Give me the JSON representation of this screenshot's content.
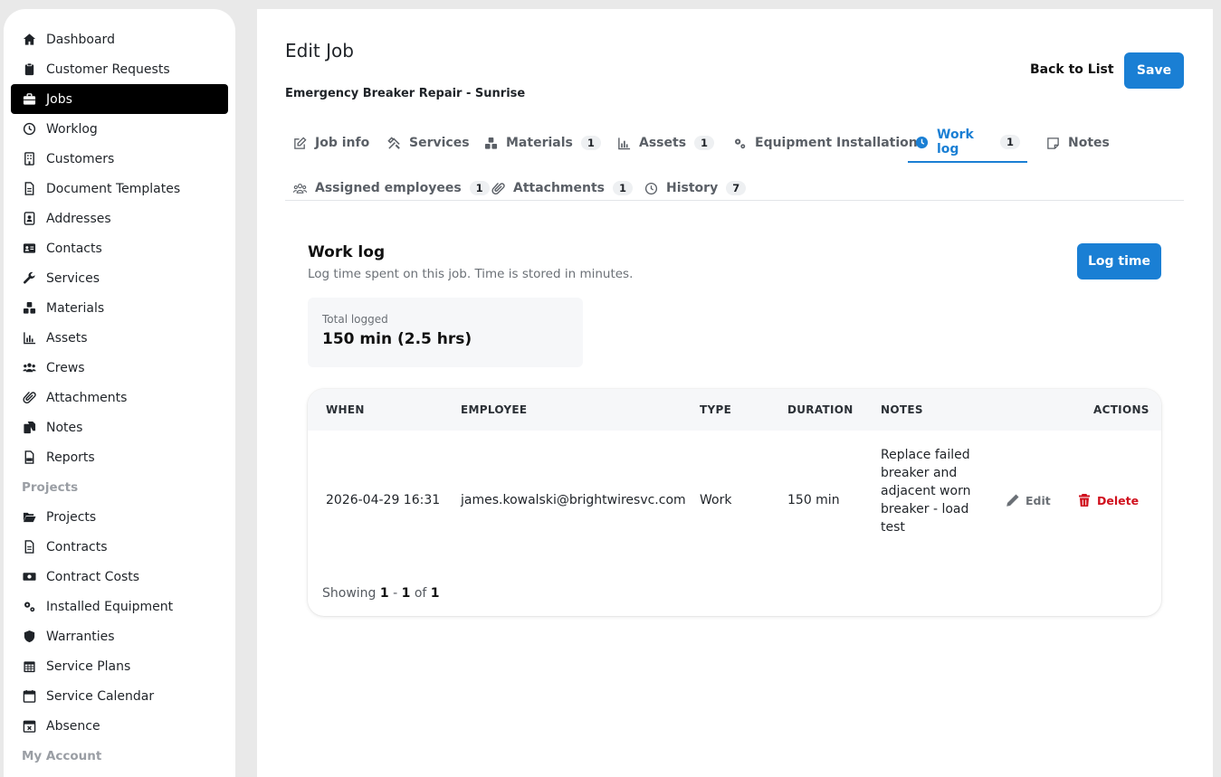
{
  "sidebar": {
    "items": [
      {
        "label": "Dashboard",
        "icon": "home-icon"
      },
      {
        "label": "Customer Requests",
        "icon": "clipboard-icon"
      },
      {
        "label": "Jobs",
        "icon": "briefcase-icon",
        "active": true
      },
      {
        "label": "Worklog",
        "icon": "clock-icon"
      },
      {
        "label": "Customers",
        "icon": "building-icon"
      },
      {
        "label": "Document Templates",
        "icon": "document-icon"
      },
      {
        "label": "Addresses",
        "icon": "address-book-icon"
      },
      {
        "label": "Contacts",
        "icon": "id-card-icon"
      },
      {
        "label": "Services",
        "icon": "wrench-icon"
      },
      {
        "label": "Materials",
        "icon": "cubes-icon"
      },
      {
        "label": "Assets",
        "icon": "chart-icon"
      },
      {
        "label": "Crews",
        "icon": "users-icon"
      },
      {
        "label": "Attachments",
        "icon": "paperclip-icon"
      },
      {
        "label": "Notes",
        "icon": "notes-icon"
      },
      {
        "label": "Reports",
        "icon": "pdf-icon"
      }
    ],
    "projects_heading": "Projects",
    "project_items": [
      {
        "label": "Projects",
        "icon": "folder-open-icon"
      },
      {
        "label": "Contracts",
        "icon": "document-icon"
      },
      {
        "label": "Contract Costs",
        "icon": "money-icon"
      },
      {
        "label": "Installed Equipment",
        "icon": "gears-icon"
      },
      {
        "label": "Warranties",
        "icon": "shield-icon"
      },
      {
        "label": "Service Plans",
        "icon": "calendar-grid-icon"
      },
      {
        "label": "Service Calendar",
        "icon": "calendar-icon"
      },
      {
        "label": "Absence",
        "icon": "calendar-x-icon"
      }
    ],
    "account_heading": "My Account"
  },
  "header": {
    "title": "Edit Job",
    "subtitle": "Emergency Breaker Repair - Sunrise",
    "back_label": "Back to List",
    "save_label": "Save"
  },
  "tabs": [
    {
      "label": "Job info",
      "icon": "edit-icon",
      "badge": ""
    },
    {
      "label": "Services",
      "icon": "tools-icon",
      "badge": ""
    },
    {
      "label": "Materials",
      "icon": "cubes-icon",
      "badge": "1"
    },
    {
      "label": "Assets",
      "icon": "chart-icon",
      "badge": "1"
    },
    {
      "label": "Equipment Installation",
      "icon": "gears-icon",
      "badge": ""
    },
    {
      "label": "Work log",
      "icon": "clock-icon",
      "badge": "1",
      "active": true
    },
    {
      "label": "Notes",
      "icon": "note-icon",
      "badge": ""
    },
    {
      "label": "Assigned employees",
      "icon": "users-icon",
      "badge": "1"
    },
    {
      "label": "Attachments",
      "icon": "paperclip-icon",
      "badge": "1"
    },
    {
      "label": "History",
      "icon": "history-icon",
      "badge": "7"
    }
  ],
  "worklog": {
    "title": "Work log",
    "description": "Log time spent on this job. Time is stored in minutes.",
    "log_button": "Log time",
    "total_label": "Total logged",
    "total_value": "150 min (2.5 hrs)"
  },
  "table": {
    "columns": [
      "WHEN",
      "EMPLOYEE",
      "TYPE",
      "DURATION",
      "NOTES",
      "ACTIONS"
    ],
    "rows": [
      {
        "when": "2026-04-29 16:31",
        "employee": "james.kowalski@brightwiresvc.com",
        "type": "Work",
        "duration": "150 min",
        "notes": "Replace failed breaker and adjacent worn breaker - load test",
        "edit_label": "Edit",
        "delete_label": "Delete"
      }
    ],
    "pager": {
      "prefix": "Showing",
      "from": "1",
      "dash": "-",
      "to": "1",
      "of": "of",
      "total": "1"
    }
  },
  "colors": {
    "accent": "#1a7fd4",
    "danger": "#d0101d",
    "active_nav": "#000000"
  }
}
